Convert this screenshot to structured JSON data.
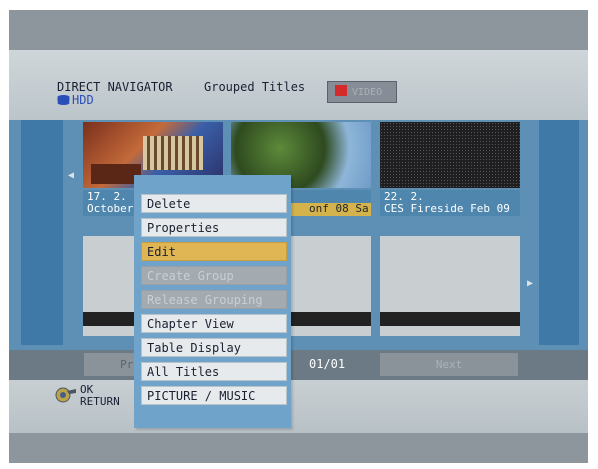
{
  "header": {
    "title": "DIRECT NAVIGATOR",
    "subtitle": "Grouped Titles",
    "drive": "HDD",
    "video_tab": "VIDEO"
  },
  "thumbnails": [
    {
      "date": "17. 2.",
      "title": "October"
    },
    {
      "date": "",
      "title": "onf 08 Sa"
    },
    {
      "date": "22. 2.",
      "title": "CES Fireside Feb 09"
    }
  ],
  "navigation": {
    "prev": "Pre",
    "page": "01/01",
    "next": "Next"
  },
  "footer": {
    "ok": "OK",
    "return": "RETURN"
  },
  "menu": {
    "items": [
      {
        "label": "Delete",
        "state": "normal"
      },
      {
        "label": "Properties",
        "state": "normal"
      },
      {
        "label": "Edit",
        "state": "selected"
      },
      {
        "label": "Create Group",
        "state": "disabled"
      },
      {
        "label": "Release Grouping",
        "state": "disabled"
      },
      {
        "label": "Chapter View",
        "state": "normal"
      },
      {
        "label": "Table Display",
        "state": "normal"
      },
      {
        "label": "All Titles",
        "state": "normal"
      },
      {
        "label": "PICTURE / MUSIC",
        "state": "normal"
      }
    ]
  },
  "colors": {
    "selected": "#e0b654",
    "panel": "#6fa3c9",
    "record": "#d32b2b"
  },
  "icons": [
    "hdd-icon",
    "record-icon",
    "left-arrow-icon",
    "right-arrow-icon",
    "ok-return-icon"
  ]
}
